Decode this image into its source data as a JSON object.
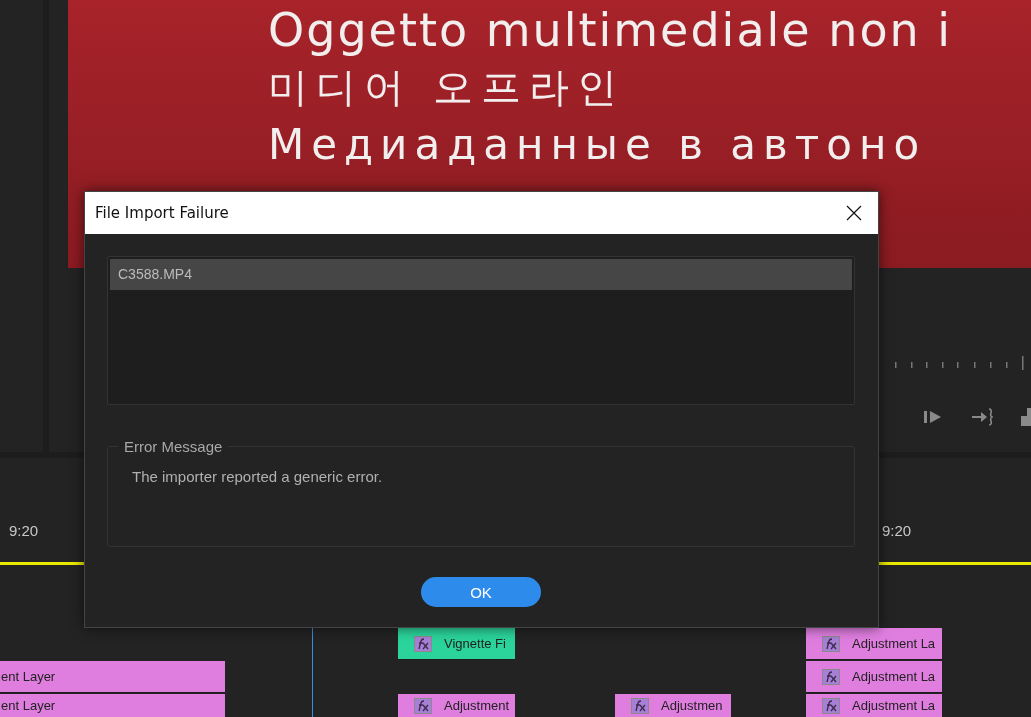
{
  "monitor": {
    "lines": [
      "Oggetto multimediale non i",
      "미디어 오프라인",
      "Медиаданные в автоно"
    ]
  },
  "dialog": {
    "title": "File Import Failure",
    "files": [
      {
        "name": "C3588.MP4",
        "selected": true
      }
    ],
    "error_group": "Error Message",
    "error_message": "The importer reported a generic error.",
    "ok_label": "OK"
  },
  "timeline": {
    "timecodes": [
      "9:20",
      "9:20"
    ],
    "tracks": [
      {
        "clips": [
          {
            "label": "Vignette Fi",
            "color": "#2bd49b",
            "fx": true
          },
          {
            "label": "Adjustment La",
            "color": "#e07ee0",
            "fx": true
          }
        ]
      },
      {
        "clips": [
          {
            "label": "ent Layer",
            "color": "#e07ee0",
            "fx": false
          },
          {
            "label": "Adjustment La",
            "color": "#e07ee0",
            "fx": true
          }
        ]
      },
      {
        "clips": [
          {
            "label": "ent Layer",
            "color": "#e07ee0",
            "fx": false
          },
          {
            "label": "Adjustment",
            "color": "#e07ee0",
            "fx": true
          },
          {
            "label": "Adjustmen",
            "color": "#e07ee0",
            "fx": true
          },
          {
            "label": "Adjustment La",
            "color": "#e07ee0",
            "fx": true
          }
        ]
      }
    ]
  }
}
